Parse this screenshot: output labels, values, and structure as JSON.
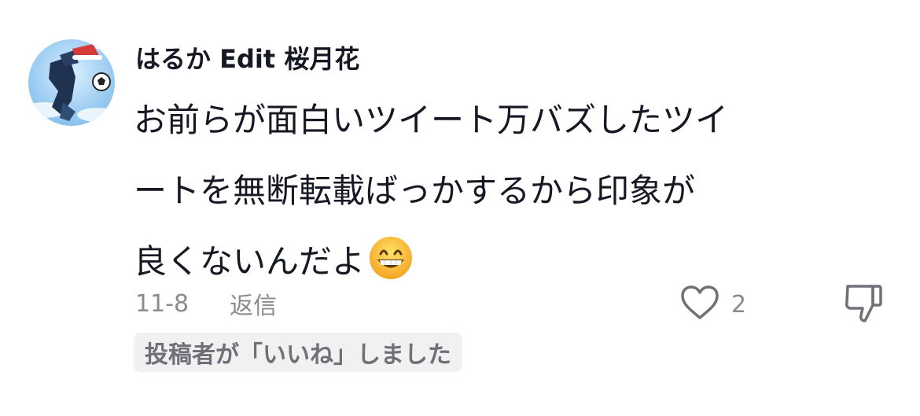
{
  "comment": {
    "username": "はるか Edit 桜月花",
    "lines": [
      "お前らが面白いツイート万バズしたツイ",
      "ートを無断転載ばっかするから印象が",
      "良くないんだよ"
    ],
    "emoji": "grinning-face-with-smiling-eyes",
    "date": "11-8",
    "reply_label": "返信",
    "like_count": "2",
    "creator_liked_badge": "投稿者が「いいね」しました"
  },
  "icons": {
    "like": "heart-outline-icon",
    "dislike": "thumbs-down-outline-icon"
  },
  "colors": {
    "text_primary": "#161823",
    "text_secondary": "#8a8b91",
    "badge_bg": "#f1f1f2",
    "badge_text": "#6f7078"
  }
}
